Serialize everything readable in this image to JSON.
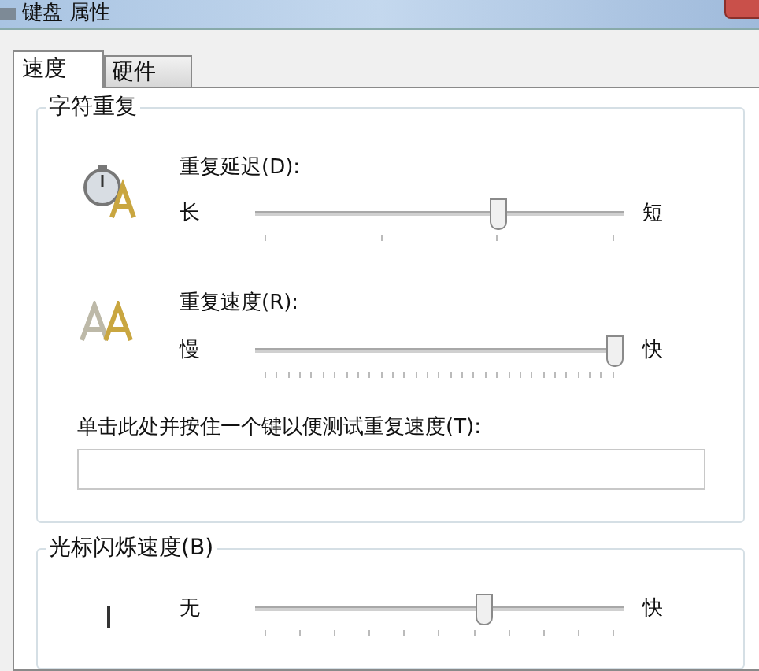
{
  "window": {
    "title": "键盘 属性"
  },
  "tabs": [
    {
      "label": "速度",
      "selected": true
    },
    {
      "label": "硬件",
      "selected": false
    }
  ],
  "groups": [
    {
      "title": "字符重复",
      "sliders": [
        {
          "kind": "delay",
          "label": "重复延迟(D):",
          "min_label": "长",
          "max_label": "短",
          "level": 0.667
        },
        {
          "kind": "rate",
          "label": "重复速度(R):",
          "min_label": "慢",
          "max_label": "快",
          "level": 1
        }
      ],
      "test": {
        "label": "单击此处并按住一个键以便测试重复速度(T):"
      }
    },
    {
      "title": "光标闪烁速度(B)",
      "sliders": [
        {
          "kind": "cursor",
          "min_label": "无",
          "max_label": "快",
          "level": 0.63
        }
      ]
    }
  ]
}
